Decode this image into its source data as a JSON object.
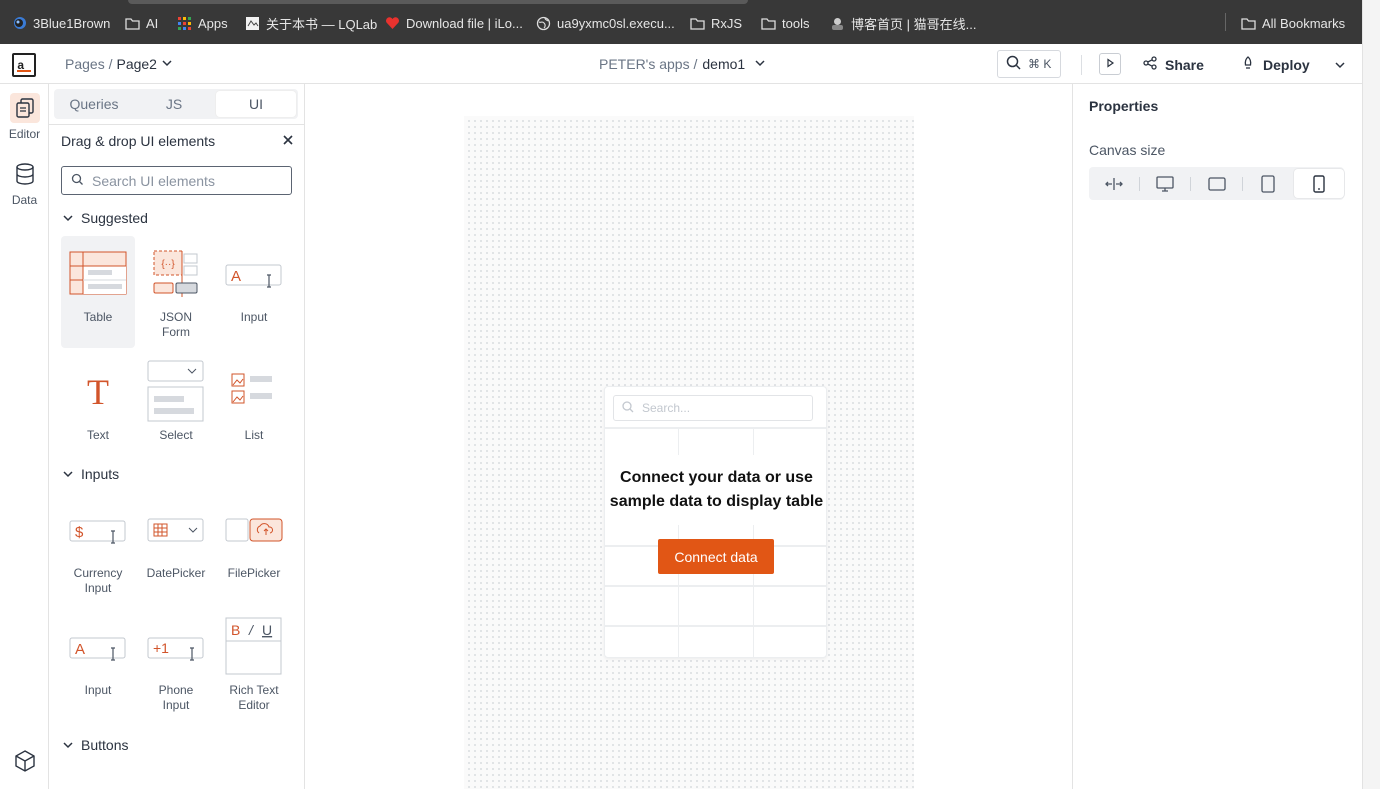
{
  "bookmarks": [
    {
      "label": "3Blue1Brown",
      "icon": "3b1b-icon"
    },
    {
      "label": "AI",
      "icon": "folder-icon"
    },
    {
      "label": "Apps",
      "icon": "apps-grid-icon"
    },
    {
      "label": "关于本书 — LQLab",
      "icon": "site-favicon-icon"
    },
    {
      "label": "Download file | iLo...",
      "icon": "heart-favicon-icon"
    },
    {
      "label": "ua9yxmc0sl.execu...",
      "icon": "globe-icon"
    },
    {
      "label": "RxJS",
      "icon": "folder-icon"
    },
    {
      "label": "tools",
      "icon": "folder-icon"
    },
    {
      "label": "博客首页 | 猫哥在线...",
      "icon": "avatar-favicon-icon"
    }
  ],
  "all_bookmarks": "All Bookmarks",
  "header": {
    "logo": "a_",
    "pages_label": "Pages /",
    "current_page": "Page2",
    "workspace": "PETER's apps /",
    "app_name": "demo1",
    "search_shortcut": "⌘ K",
    "share_label": "Share",
    "deploy_label": "Deploy"
  },
  "rail": {
    "editor_label": "Editor",
    "data_label": "Data"
  },
  "panel": {
    "tabs": [
      "Queries",
      "JS",
      "UI"
    ],
    "active_tab": "UI",
    "title": "Drag & drop UI elements",
    "search_placeholder": "Search UI elements",
    "sections": {
      "suggested": "Suggested",
      "inputs": "Inputs",
      "buttons": "Buttons"
    },
    "suggested_widgets": [
      "Table",
      "JSON\nForm",
      "Input",
      "Text",
      "Select",
      "List"
    ],
    "input_widgets": [
      "Currency\nInput",
      "DatePicker",
      "FilePicker",
      "Input",
      "Phone\nInput",
      "Rich Text\nEditor"
    ]
  },
  "canvas": {
    "table_search_placeholder": "Search...",
    "empty_message": "Connect your data or use sample data to display table",
    "connect_button": "Connect data"
  },
  "properties": {
    "title": "Properties",
    "canvas_size_label": "Canvas size",
    "size_options": [
      "fluid-width-icon",
      "desktop-icon",
      "tablet-landscape-icon",
      "tablet-portrait-icon",
      "mobile-icon"
    ],
    "selected_size": "mobile-icon"
  },
  "colors": {
    "accent": "#e15615",
    "dark_bar": "#383838"
  }
}
